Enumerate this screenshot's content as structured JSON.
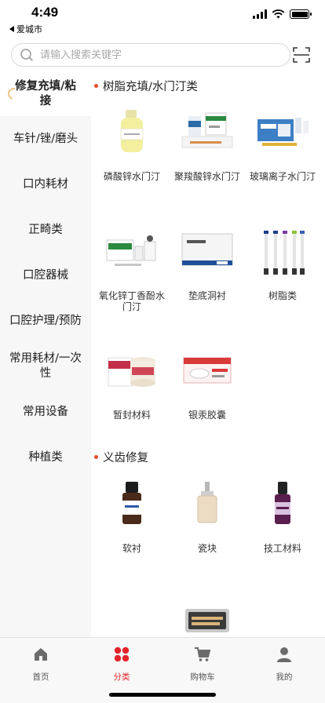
{
  "status": {
    "time": "4:49",
    "back_app": "爱城市"
  },
  "search": {
    "placeholder": "请输入搜索关键字"
  },
  "sidebar": {
    "items": [
      {
        "label": "修复充填/粘接",
        "active": true
      },
      {
        "label": "车针/锉/磨头"
      },
      {
        "label": "口内耗材"
      },
      {
        "label": "正畸类"
      },
      {
        "label": "口腔器械"
      },
      {
        "label": "口腔护理/预防"
      },
      {
        "label": "常用耗材/一次性"
      },
      {
        "label": "常用设备"
      },
      {
        "label": "种植类"
      }
    ]
  },
  "sections": [
    {
      "title": "树脂充填/水门汀类",
      "products": [
        {
          "name": "磷酸锌水门汀"
        },
        {
          "name": "聚羧酸锌水门汀"
        },
        {
          "name": "玻璃离子水门汀"
        },
        {
          "name": "氧化锌丁香酚水门汀"
        },
        {
          "name": "垫底洞衬"
        },
        {
          "name": "树脂类"
        },
        {
          "name": "暂封材料"
        },
        {
          "name": "银汞胶囊"
        }
      ]
    },
    {
      "title": "义齿修复",
      "products": [
        {
          "name": "软衬"
        },
        {
          "name": "瓷块"
        },
        {
          "name": "技工材料"
        }
      ]
    }
  ],
  "tabbar": {
    "items": [
      {
        "label": "首页",
        "icon": "home-icon"
      },
      {
        "label": "分类",
        "icon": "category-icon",
        "active": true
      },
      {
        "label": "购物车",
        "icon": "cart-icon"
      },
      {
        "label": "我的",
        "icon": "profile-icon"
      }
    ]
  },
  "colors": {
    "accent": "#e3252b",
    "section_dot": "#e64a2e",
    "sidebar_bg": "#f7f7f7"
  }
}
